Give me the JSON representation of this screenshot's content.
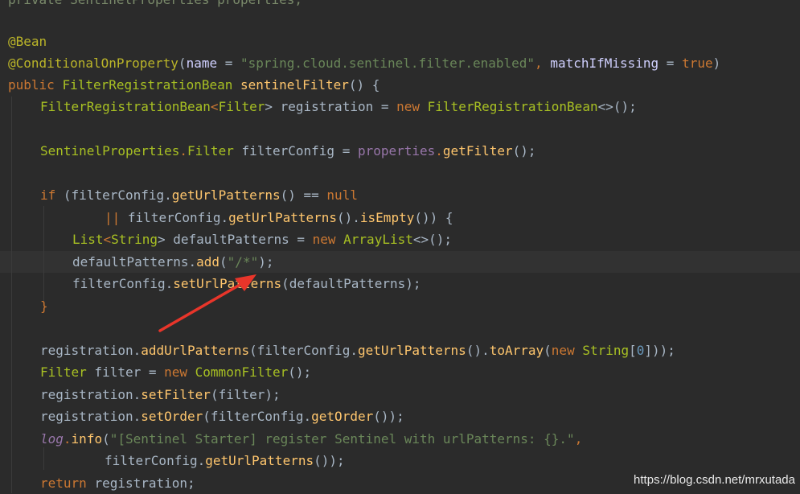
{
  "editor": {
    "lines": {
      "l0": [
        "private ",
        "SentinelProperties",
        " properties;"
      ],
      "l1": [
        "@Bean"
      ],
      "l2": [
        "@ConditionalOnProperty",
        "(",
        "name",
        " = ",
        "\"spring.cloud.sentinel.filter.enabled\"",
        ", ",
        "matchIfMissing",
        " = ",
        "true",
        ")"
      ],
      "l3": [
        "public ",
        "FilterRegistrationBean",
        " ",
        "sentinelFilter",
        "() {"
      ],
      "l4": [
        "FilterRegistrationBean",
        "<",
        "Filter",
        "> registration = ",
        "new ",
        "FilterRegistrationBean",
        "<>();"
      ],
      "l5": [
        "SentinelProperties",
        ".",
        "Filter",
        " filterConfig = ",
        "properties",
        ".",
        "getFilter",
        "();"
      ],
      "l6": [
        "if ",
        "(filterConfig.",
        "getUrlPatterns",
        "() == ",
        "null"
      ],
      "l7": [
        "|| ",
        "filterConfig.",
        "getUrlPatterns",
        "().",
        "isEmpty",
        "()) {"
      ],
      "l8": [
        "List",
        "<",
        "String",
        "> defaultPatterns = ",
        "new ",
        "ArrayList",
        "<>();"
      ],
      "l9": [
        "defaultPatterns.",
        "add",
        "(",
        "\"/*\"",
        ");"
      ],
      "l10": [
        "filterConfig.",
        "setUrlPatterns",
        "(defaultPatterns);"
      ],
      "l11": [
        "}"
      ],
      "l12": [
        "registration.",
        "addUrlPatterns",
        "(filterConfig.",
        "getUrlPatterns",
        "().",
        "toArray",
        "(",
        "new ",
        "String",
        "[",
        "0",
        "]));"
      ],
      "l13": [
        "Filter",
        " filter = ",
        "new ",
        "CommonFilter",
        "();"
      ],
      "l14": [
        "registration.",
        "setFilter",
        "(filter);"
      ],
      "l15": [
        "registration.",
        "setOrder",
        "(filterConfig.",
        "getOrder",
        "());"
      ],
      "l16": [
        "log",
        ".",
        "info",
        "(",
        "\"[Sentinel Starter] register Sentinel with urlPatterns: {}.\"",
        ","
      ],
      "l17": [
        "filterConfig.",
        "getUrlPatterns",
        "());"
      ],
      "l18": [
        "return ",
        "registration;"
      ]
    }
  },
  "watermark": "https://blog.csdn.net/mrxutada",
  "colors": {
    "background": "#2b2b2b",
    "keyword": "#cc7832",
    "string": "#6a8759",
    "type": "#a8c023",
    "method": "#ffc66d",
    "annotation": "#bbb529",
    "arrow": "#e8352a"
  }
}
